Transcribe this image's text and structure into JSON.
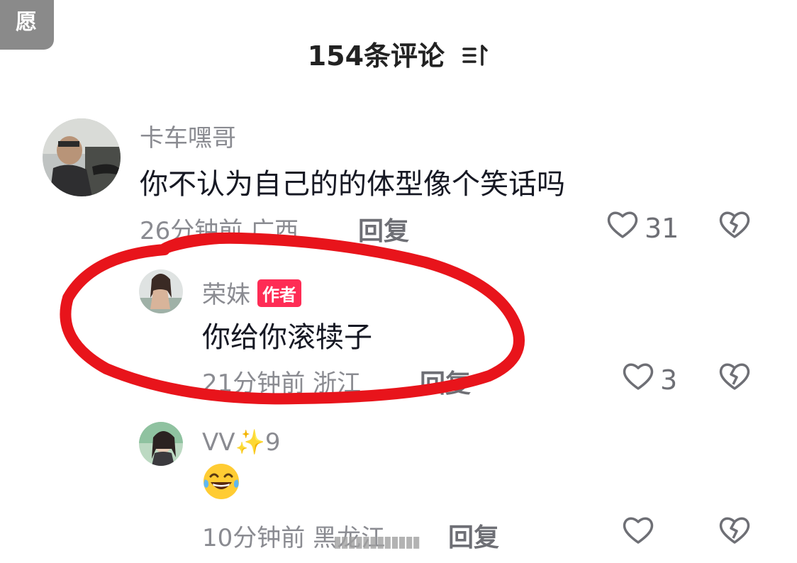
{
  "corner_tag": "愿",
  "header": {
    "title": "154条评论"
  },
  "comments": [
    {
      "username": "卡车嘿哥",
      "text": "你不认为自己的的体型像个笑话吗",
      "time": "26分钟前",
      "location": "广西",
      "reply_label": "回复",
      "likes": "31",
      "is_author": false
    },
    {
      "username": "荣妹",
      "badge": "作者",
      "text": "你给你滚犊子",
      "time": "21分钟前",
      "location": "浙江",
      "reply_label": "回复",
      "likes": "3",
      "is_author": true
    },
    {
      "username": "VV✨9",
      "text": "😂",
      "time": "10分钟前",
      "location": "黑龙江",
      "reply_label": "回复",
      "likes": "",
      "is_author": false
    }
  ],
  "colors": {
    "badge": "#fe2c55",
    "highlight_circle": "#e8141b",
    "secondary_text": "#8a8b91"
  },
  "icons": {
    "like": "heart-outline-icon",
    "dislike": "broken-heart-icon",
    "sort": "sort-icon"
  }
}
